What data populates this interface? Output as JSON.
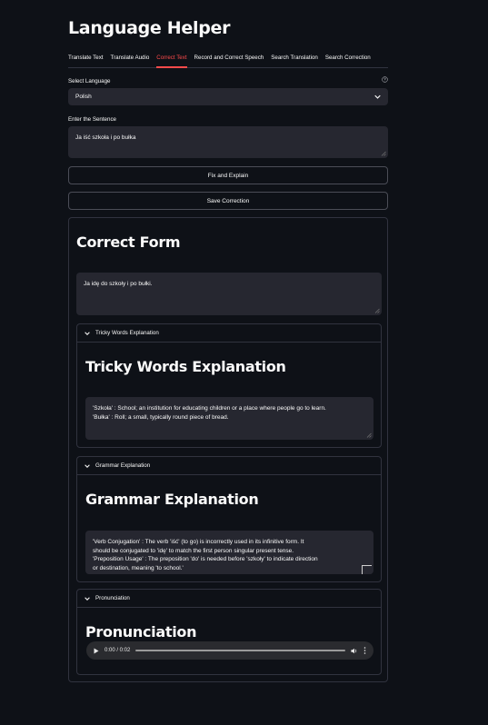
{
  "app": {
    "title": "Language Helper"
  },
  "tabs": [
    {
      "label": "Translate Text"
    },
    {
      "label": "Translate Audio"
    },
    {
      "label": "Correct Text",
      "active": true
    },
    {
      "label": "Record and Correct Speech"
    },
    {
      "label": "Search Translation"
    },
    {
      "label": "Search Correction"
    }
  ],
  "language": {
    "label": "Select Language",
    "value": "Polish"
  },
  "sentence": {
    "label": "Enter the Sentence",
    "value": "Ja iść szkoła i po bułka"
  },
  "buttons": {
    "fix": "Fix and Explain",
    "save": "Save Correction"
  },
  "correct": {
    "heading": "Correct Form",
    "text": "Ja idę do szkoły i po bułki."
  },
  "tricky": {
    "header": "Tricky Words Explanation",
    "heading": "Tricky Words Explanation",
    "line1": "'Szkoła' : School; an institution for educating children or a place where people go to learn.",
    "line2": "'Bułka' : Roll; a small, typically round piece of bread."
  },
  "grammar": {
    "header": "Grammar Explanation",
    "heading": "Grammar Explanation",
    "line1": "'Verb Conjugation' : The verb 'iść' (to go) is incorrectly used in its infinitive form. It",
    "line2": "should be conjugated to 'idę' to match the first person singular present tense.",
    "line3": "'Preposition Usage' : The preposition 'do' is needed before 'szkoły' to indicate direction",
    "line4": "or destination, meaning 'to school.'"
  },
  "pronunciation": {
    "header": "Pronunciation",
    "heading": "Pronunciation",
    "time": "0:00 / 0:02"
  },
  "colors": {
    "accent": "#ff4b4b",
    "background": "#0e1117",
    "input": "#262730"
  },
  "icons": [
    "help-icon",
    "chevron-down-icon",
    "play-icon",
    "volume-icon",
    "more-icon"
  ]
}
